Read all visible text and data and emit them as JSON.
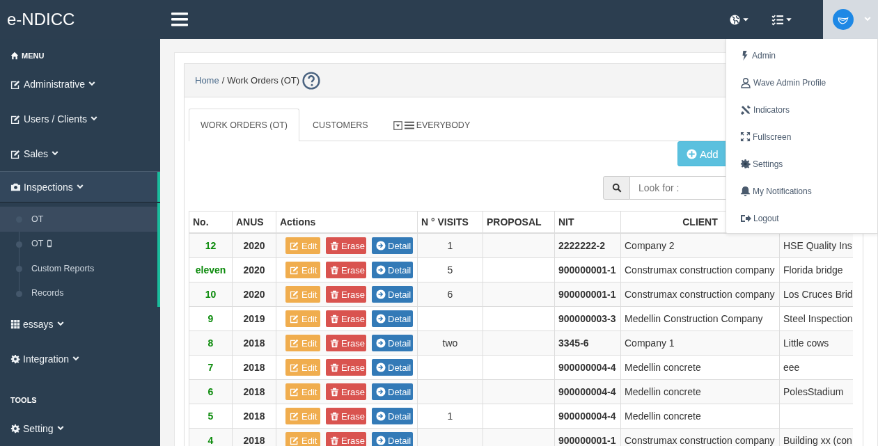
{
  "topbar": {
    "brand": "e-NDICC"
  },
  "sidebar": {
    "sections": [
      {
        "heading": "MENU",
        "items": [
          {
            "label": "Administrative",
            "expanded": false
          },
          {
            "label": "Users / Clients",
            "expanded": false
          },
          {
            "label": "Sales",
            "expanded": false
          },
          {
            "label": "Inspections",
            "expanded": true,
            "children": [
              {
                "label": "OT",
                "selected": true
              },
              {
                "label": "OT",
                "selected": false
              },
              {
                "label": "Custom Reports",
                "selected": false
              },
              {
                "label": "Records",
                "selected": false
              }
            ]
          },
          {
            "label": "essays",
            "expanded": false
          },
          {
            "label": "Integration",
            "expanded": false
          }
        ]
      },
      {
        "heading": "TOOLS",
        "items": [
          {
            "label": "Setting",
            "expanded": false
          }
        ]
      }
    ]
  },
  "breadcrumb": {
    "home": "Home",
    "separator": "/",
    "current": "Work Orders (OT)"
  },
  "tabs": [
    {
      "label": "WORK ORDERS (OT)",
      "selected": true
    },
    {
      "label": "CUSTOMERS",
      "selected": false
    },
    {
      "label": "EVERYBODY",
      "selected": false
    }
  ],
  "add_button": "Add",
  "search": {
    "placeholder": "Look for :"
  },
  "table": {
    "columns": [
      "No.",
      "ANUS",
      "Actions",
      "N ° VISITS",
      "PROPOSAL",
      "NIT",
      "CLIENT"
    ],
    "rows": [
      {
        "no": "12",
        "year": "2020",
        "actions": [
          "Edit",
          "Erase",
          "Detail"
        ],
        "visits": "1",
        "nit": "2222222-2",
        "client": "Company 2",
        "column_8": "HSE Quality Ins"
      },
      {
        "no": "eleven",
        "year": "2020",
        "actions": [
          "Edit",
          "Erase",
          "Detail"
        ],
        "visits": "5",
        "nit": "900000001-1",
        "client": "Construmax construction company",
        "column_8": "Florida bridge"
      },
      {
        "no": "10",
        "year": "2020",
        "actions": [
          "Edit",
          "Erase",
          "Detail"
        ],
        "visits": "6",
        "nit": "900000001-1",
        "client": "Construmax construction company",
        "column_8": "Los Cruces Brid"
      },
      {
        "no": "9",
        "year": "2019",
        "actions": [
          "Edit",
          "Erase",
          "Detail"
        ],
        "nit": "900000003-3",
        "client": "Medellin Construction Company",
        "column_8": "Steel Inspection"
      },
      {
        "no": "8",
        "year": "2018",
        "actions": [
          "Edit",
          "Erase",
          "Detail"
        ],
        "visits": "two",
        "nit": "3345-6",
        "client": "Company 1",
        "column_8": "Little cows"
      },
      {
        "no": "7",
        "year": "2018",
        "actions": [
          "Edit",
          "Erase",
          "Detail"
        ],
        "nit": "900000004-4",
        "client": "Medellin concrete",
        "column_8": "eee"
      },
      {
        "no": "6",
        "year": "2018",
        "actions": [
          "Edit",
          "Erase",
          "Detail"
        ],
        "nit": "900000004-4",
        "client": "Medellin concrete",
        "column_8": "PolesStadium"
      },
      {
        "no": "5",
        "year": "2018",
        "actions": [
          "Edit",
          "Erase",
          "Detail"
        ],
        "visits": "1",
        "nit": "900000004-4",
        "client": "Medellin concrete"
      },
      {
        "no": "4",
        "year": "2018",
        "actions": [
          "Edit",
          "Erase",
          "Detail"
        ],
        "nit": "900000001-1",
        "client": "Construmax construction company",
        "column_8": "Building xx (con"
      }
    ]
  },
  "user_menu": {
    "open": true,
    "items": [
      "Admin",
      "Wave Admin Profile",
      "Indicators",
      "Fullscreen",
      "Settings",
      "My Notifications",
      "Logout"
    ]
  }
}
